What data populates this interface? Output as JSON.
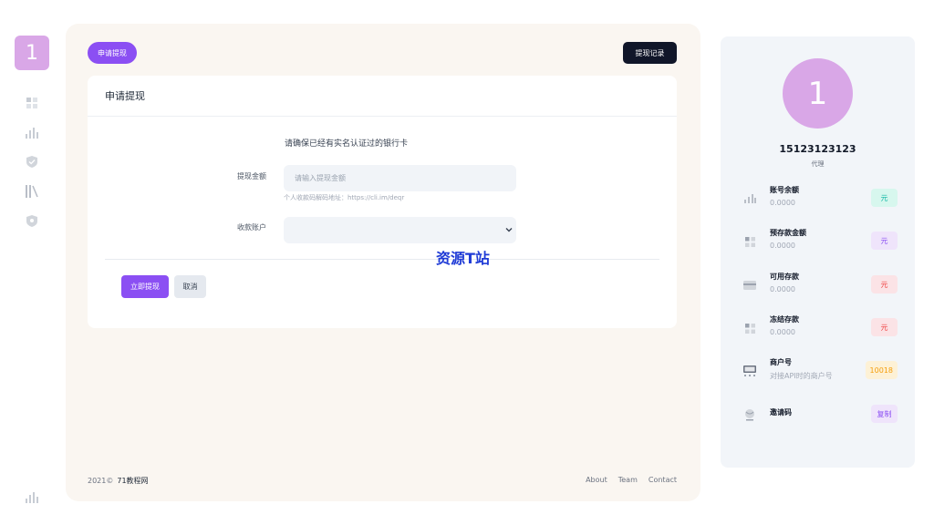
{
  "rail": {
    "logo": "1",
    "icons": [
      "grid-icon",
      "bar-chart-icon",
      "shield-check-icon",
      "library-icon",
      "shield-badge-icon"
    ],
    "bottom_icon": "bar-chart-icon"
  },
  "header": {
    "apply_pill": "申请提现",
    "records_button": "提现记录"
  },
  "form": {
    "title": "申请提现",
    "notice": "请确保已经有实名认证过的银行卡",
    "amount_label": "提现金额",
    "amount_placeholder": "请输入提现金额",
    "hint": "个人收款码解码地址：https://cli.im/deqr",
    "account_label": "收款账户",
    "account_value": "",
    "submit_button": "立即提现",
    "cancel_button": "取消"
  },
  "watermark": "资源T站",
  "footer": {
    "year": "2021©",
    "brand": "71教程网",
    "links": [
      "About",
      "Team",
      "Contact"
    ]
  },
  "profile": {
    "avatar": "1",
    "username": "15123123123",
    "role": "代理",
    "stats": [
      {
        "icon": "bar-chart-icon",
        "label": "账号余额",
        "value": "0.0000",
        "badge": "元",
        "badge_bg": "#d7f7ee",
        "badge_color": "#14b8a6"
      },
      {
        "icon": "grid-icon",
        "label": "预存款金额",
        "value": "0.0000",
        "badge": "元",
        "badge_bg": "#efe4fb",
        "badge_color": "#8b4ff3"
      },
      {
        "icon": "card-icon",
        "label": "可用存款",
        "value": "0.0000",
        "badge": "元",
        "badge_bg": "#fbe3e6",
        "badge_color": "#ef4444"
      },
      {
        "icon": "grid-icon",
        "label": "冻结存款",
        "value": "0.0000",
        "badge": "元",
        "badge_bg": "#fbe3e6",
        "badge_color": "#ef4444"
      },
      {
        "icon": "terminal-icon",
        "label": "商户号",
        "value": "对接API时的商户号",
        "badge": "10018",
        "badge_bg": "#fdf1d6",
        "badge_color": "#f59e0b"
      },
      {
        "icon": "globe-icon",
        "label": "邀请码",
        "value": "",
        "badge": "复制",
        "badge_bg": "#efe4fb",
        "badge_color": "#8b4ff3"
      }
    ]
  }
}
